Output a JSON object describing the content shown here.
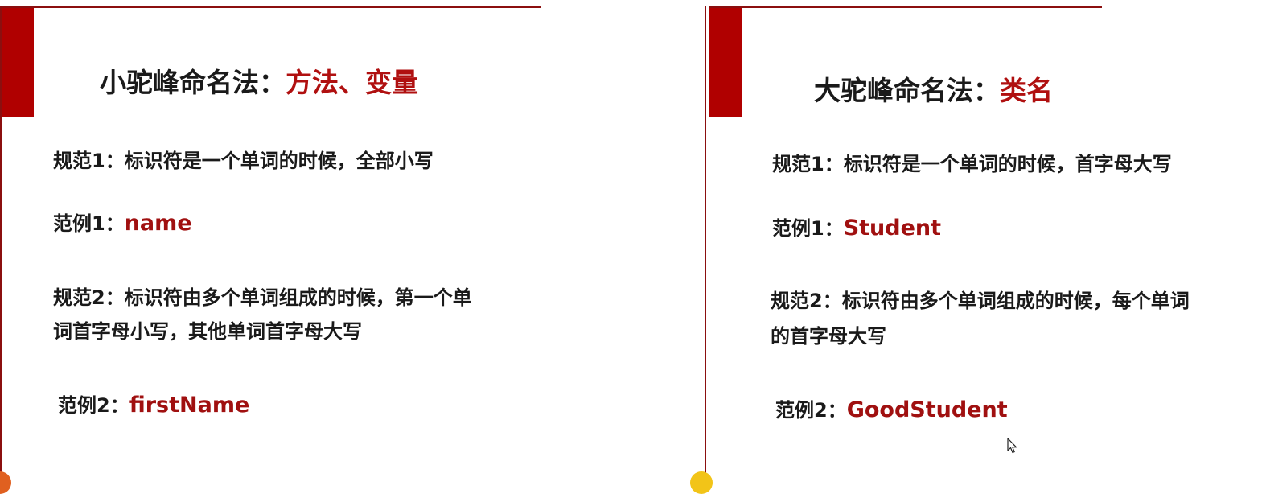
{
  "left": {
    "title_main": "小驼峰命名法：",
    "title_highlight": "方法、变量",
    "rule1": "规范1：标识符是一个单词的时候，全部小写",
    "example1_label": "范例1：",
    "example1_value": "name",
    "rule2_line1": "规范2：标识符由多个单词组成的时候，第一个单",
    "rule2_line2": "词首字母小写，其他单词首字母大写",
    "example2_label": "范例2：",
    "example2_value": "firstName"
  },
  "right": {
    "title_main": "大驼峰命名法：",
    "title_highlight": "类名",
    "rule1": "规范1：标识符是一个单词的时候，首字母大写",
    "example1_label": "范例1：",
    "example1_value": "Student",
    "rule2_line1": "规范2：标识符由多个单词组成的时候，每个单词",
    "rule2_line2": "的首字母大写",
    "example2_label": "范例2：",
    "example2_value": "GoodStudent"
  },
  "colors": {
    "accent": "#b00000",
    "highlight_text": "#b01010",
    "rule_line": "#8b0f0f"
  },
  "icons": [
    "mouse-pointer-icon"
  ]
}
